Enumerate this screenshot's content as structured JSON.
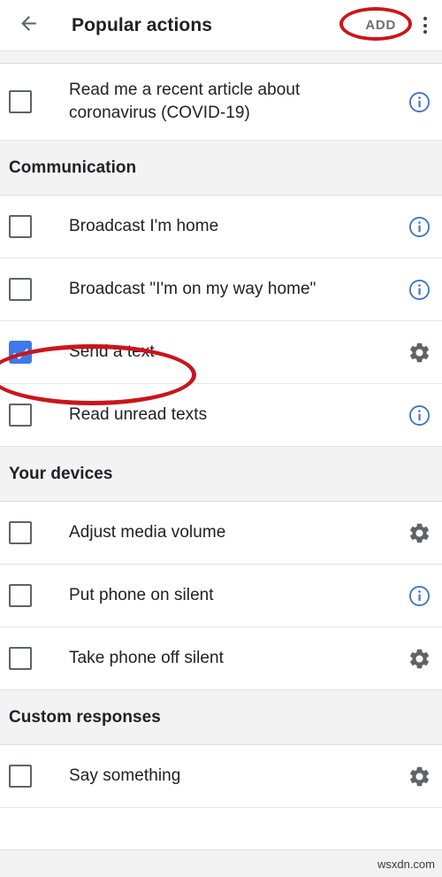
{
  "appbar": {
    "back_icon": "arrow-left-icon",
    "title": "Popular actions",
    "add_label": "ADD",
    "overflow_icon": "more-vertical-icon"
  },
  "colors": {
    "checkbox_checked": "#3e79e8",
    "info_icon": "#3f72c4",
    "gear_icon": "#5f6368",
    "annotation_red": "#c8161d",
    "section_bg": "#f3f3f4",
    "text_primary": "#202124",
    "add_text": "#6e7277"
  },
  "annotations": [
    {
      "name": "add-button-highlight",
      "target": "ADD"
    },
    {
      "name": "send-a-text-highlight",
      "target": "Send a text"
    }
  ],
  "list": [
    {
      "type": "item",
      "label": "Read me a recent article about coronavirus (COVID-19)",
      "checked": false,
      "trailing": "info-icon",
      "tall": true
    },
    {
      "type": "section",
      "label": "Communication"
    },
    {
      "type": "item",
      "label": "Broadcast I'm home",
      "checked": false,
      "trailing": "info-icon",
      "tall": false
    },
    {
      "type": "item",
      "label": "Broadcast \"I'm on my way home\"",
      "checked": false,
      "trailing": "info-icon",
      "tall": false
    },
    {
      "type": "item",
      "label": "Send a text",
      "checked": true,
      "trailing": "gear-icon",
      "tall": false
    },
    {
      "type": "item",
      "label": "Read unread texts",
      "checked": false,
      "trailing": "info-icon",
      "tall": false
    },
    {
      "type": "section",
      "label": "Your devices"
    },
    {
      "type": "item",
      "label": "Adjust media volume",
      "checked": false,
      "trailing": "gear-icon",
      "tall": false
    },
    {
      "type": "item",
      "label": "Put phone on silent",
      "checked": false,
      "trailing": "info-icon",
      "tall": false
    },
    {
      "type": "item",
      "label": "Take phone off silent",
      "checked": false,
      "trailing": "gear-icon",
      "tall": false
    },
    {
      "type": "section",
      "label": "Custom responses"
    },
    {
      "type": "item",
      "label": "Say something",
      "checked": false,
      "trailing": "gear-icon",
      "tall": false
    }
  ],
  "footer": {
    "watermark": "wsxdn.com"
  }
}
